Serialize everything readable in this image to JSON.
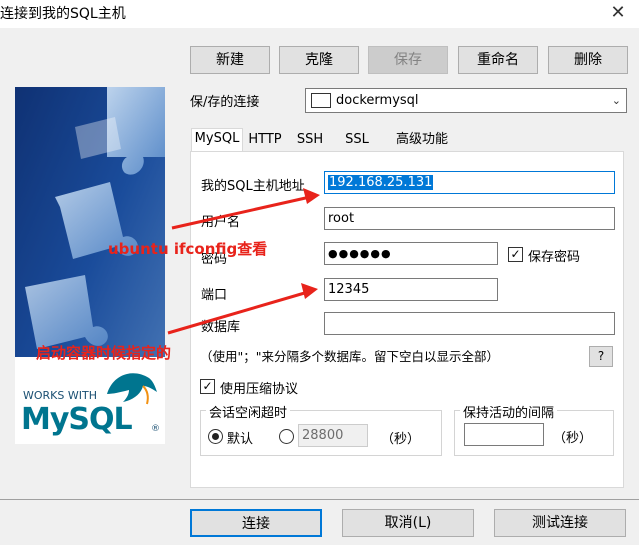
{
  "window": {
    "title": "连接到我的SQL主机",
    "close_glyph": "✕"
  },
  "toolbar": {
    "new": "新建",
    "clone": "克隆",
    "save": "保存",
    "rename": "重命名",
    "delete": "删除"
  },
  "saved_connection": {
    "label": "保/存的连接",
    "value": "dockermysql"
  },
  "tabs": [
    "MySQL",
    "HTTP",
    "SSH",
    "SSL",
    "高级功能"
  ],
  "form": {
    "host_label": "我的SQL主机地址",
    "host_value": "192.168.25.131",
    "user_label": "用户名",
    "user_value": "root",
    "password_label": "密码",
    "password_value": "●●●●●●",
    "save_password_label": "保存密码",
    "port_label": "端口",
    "port_value": "12345",
    "database_label": "数据库",
    "database_value": "",
    "database_hint": "（使用\"；\"来分隔多个数据库。留下空白以显示全部）",
    "help_label": "?",
    "compression_label": "使用压缩协议",
    "session_timeout_label": "会话空闲超时",
    "default_label": "默认",
    "timeout_value": "28800",
    "seconds_label": "（秒）",
    "keepalive_label": "保持活动的间隔",
    "keepalive_value": "",
    "keepalive_seconds_label": "（秒）"
  },
  "annotations": {
    "ifconfig": "ubuntu ifconfig查看",
    "container": "启动容器时候指定的"
  },
  "logo": {
    "line1": "WORKS WITH",
    "line2": "MySQL",
    "registered": "®"
  },
  "footer": {
    "connect": "连接",
    "cancel": "取消(L)",
    "test": "测试连接"
  },
  "colors": {
    "accent": "#0078d7",
    "annotation": "#e8231b",
    "mysql_blue": "#00758f",
    "mysql_orange": "#f29111"
  }
}
